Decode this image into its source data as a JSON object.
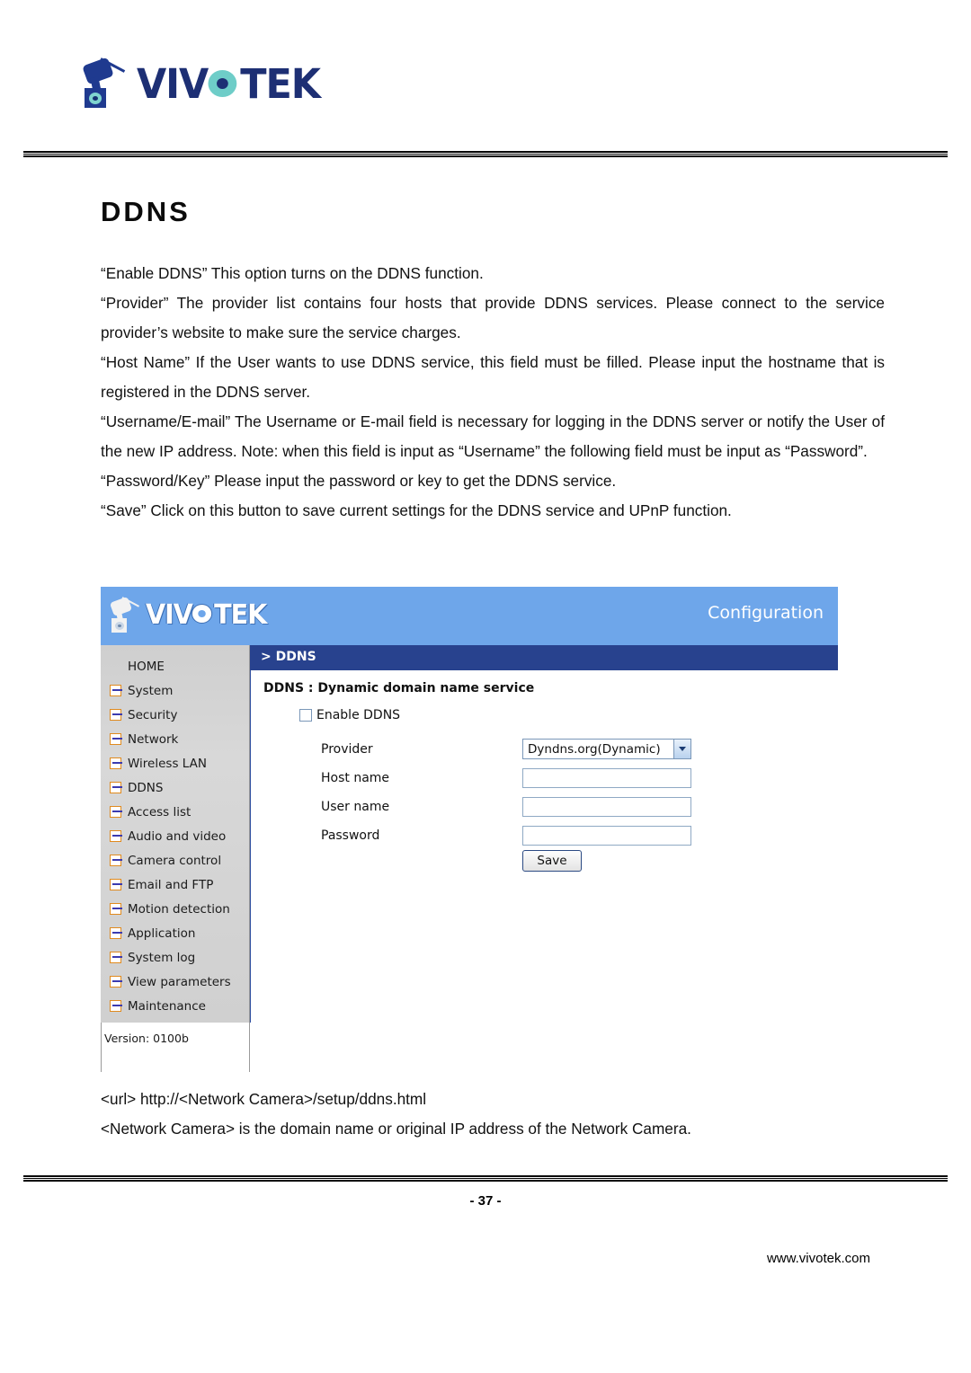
{
  "document": {
    "brand": "VIVOTEK",
    "title": "DDNS",
    "paragraphs": [
      "“Enable DDNS” This option turns on the DDNS function.",
      "“Provider” The provider list contains four hosts that provide DDNS services. Please connect to the service provider’s website to make sure the service charges.",
      "“Host Name” If the User wants to use DDNS service, this field must be filled. Please input the hostname that is registered in the DDNS server.",
      "“Username/E-mail” The Username or E-mail field is necessary for logging in the DDNS server or notify the User of the new IP address. Note: when this field is input as “Username” the following field must be input as “Password”.",
      "“Password/Key” Please input the password or key to get the DDNS service.",
      "“Save” Click on this button to save current settings for the DDNS service and UPnP function."
    ],
    "url_line": "<url> http://<Network Camera>/setup/ddns.html",
    "url_note": "<Network Camera> is the domain name or original IP address of the Network Camera.",
    "page_number": "- 37 -",
    "website": "www.vivotek.com"
  },
  "screenshot": {
    "banner": {
      "brand": "VIVOTEK",
      "section": "Configuration"
    },
    "navbar": {
      "breadcrumb": "> DDNS"
    },
    "sidebar": {
      "items": [
        {
          "label": "HOME",
          "icon": ""
        },
        {
          "label": "System",
          "icon": "arrow-icon"
        },
        {
          "label": "Security",
          "icon": "arrow-icon"
        },
        {
          "label": "Network",
          "icon": "arrow-icon"
        },
        {
          "label": "Wireless LAN",
          "icon": "arrow-icon"
        },
        {
          "label": "DDNS",
          "icon": "arrow-icon"
        },
        {
          "label": "Access list",
          "icon": "arrow-icon"
        },
        {
          "label": "Audio and video",
          "icon": "arrow-icon"
        },
        {
          "label": "Camera control",
          "icon": "arrow-icon"
        },
        {
          "label": "Email and FTP",
          "icon": "arrow-icon"
        },
        {
          "label": "Motion detection",
          "icon": "arrow-icon"
        },
        {
          "label": "Application",
          "icon": "arrow-icon"
        },
        {
          "label": "System log",
          "icon": "arrow-icon"
        },
        {
          "label": "View parameters",
          "icon": "arrow-icon"
        },
        {
          "label": "Maintenance",
          "icon": "arrow-icon"
        }
      ],
      "version": "Version: 0100b"
    },
    "form": {
      "title": "DDNS : Dynamic domain name service",
      "enable_label": "Enable DDNS",
      "enable_checked": false,
      "fields": [
        {
          "label": "Provider",
          "type": "select",
          "value": "Dyndns.org(Dynamic)"
        },
        {
          "label": "Host name",
          "type": "text",
          "value": ""
        },
        {
          "label": "User name",
          "type": "text",
          "value": ""
        },
        {
          "label": "Password",
          "type": "text",
          "value": ""
        }
      ],
      "save_label": "Save"
    }
  },
  "colors": {
    "banner_blue": "#6ea6ea",
    "navbar_navy": "#28428e",
    "sidebar_gray": "#d4d4d4",
    "icon_orange": "#e08a1e",
    "logo_navy": "#1d2f74",
    "logo_teal": "#6ecdc8"
  }
}
